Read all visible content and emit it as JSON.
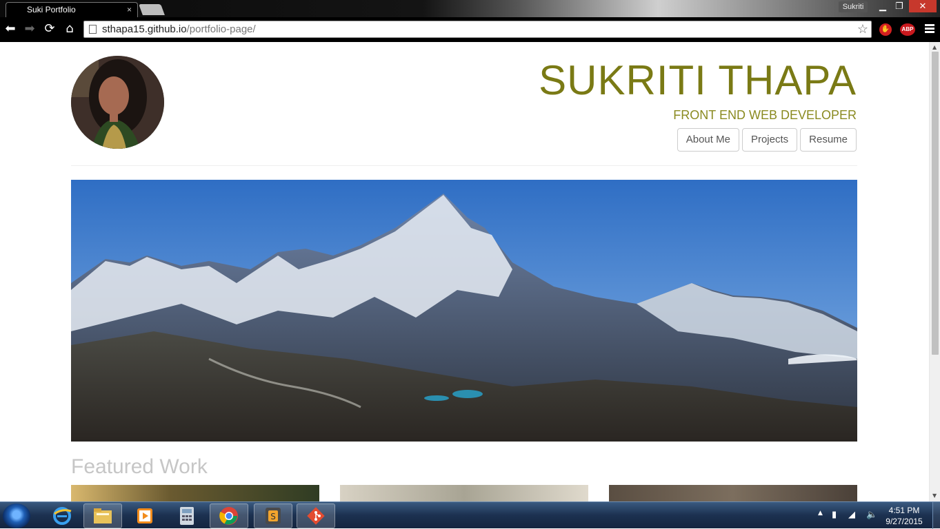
{
  "browser": {
    "tab_title": "Suki Portfolio",
    "tab_close": "×",
    "profile_name": "Sukriti",
    "window_buttons": {
      "minimize": "▁",
      "restore": "❐",
      "close": "✕"
    },
    "url_host": "sthapa15.github.io",
    "url_path": "/portfolio-page/",
    "extension_abp": "ABP",
    "extension_stop": "✋"
  },
  "header": {
    "name": "SUKRITI THAPA",
    "subtitle": "FRONT END WEB DEVELOPER",
    "nav": [
      "About Me",
      "Projects",
      "Resume"
    ]
  },
  "main": {
    "section_title": "Featured Work"
  },
  "taskbar": {
    "time": "4:51 PM",
    "date": "9/27/2015",
    "pinned": [
      "internet-explorer",
      "file-explorer",
      "media-player",
      "calculator",
      "chrome",
      "sublime-text",
      "git"
    ]
  },
  "colors": {
    "title": "#7a7a15",
    "subtitle": "#8a8a20",
    "featured": "#c6c6c6"
  }
}
